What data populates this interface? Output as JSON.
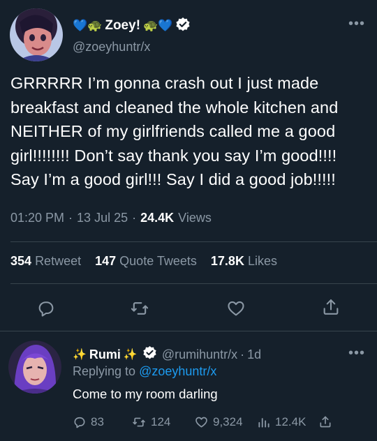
{
  "tweet": {
    "author": {
      "prefix_emoji": "💙🐢",
      "name": "Zoey!",
      "suffix_emoji": "🐢💙",
      "handle": "@zoeyhuntr/x"
    },
    "text": "GRRRRR I’m gonna crash out I just made breakfast and cleaned the whole kitchen and NEITHER of my girlfriends called me a good girl!!!!!!!! Don’t say thank you say I’m good!!!! Say I’m a good girl!!! Say I did a good job!!!!!",
    "time": "01:20 PM",
    "date": "13 Jul 25",
    "views_count": "24.4K",
    "views_label": "Views",
    "stats": {
      "retweets": "354",
      "retweets_label": "Retweet",
      "quotes": "147",
      "quotes_label": "Quote Tweets",
      "likes": "17.8K",
      "likes_label": "Likes"
    }
  },
  "reply": {
    "author": {
      "prefix_emoji": "✨",
      "name": "Rumi",
      "suffix_emoji": "✨",
      "handle": "@rumihuntr/x",
      "age": "1d"
    },
    "replying_to_label": "Replying to",
    "replying_to": "@zoeyhuntr/x",
    "text": "Come to my room darling",
    "actions": {
      "replies": "83",
      "retweets": "124",
      "likes": "9,324",
      "views": "12.4K"
    }
  },
  "colors": {
    "background": "#15202b",
    "accent": "#1d9bf0",
    "muted": "#8b98a5",
    "divider": "#38444d"
  },
  "icons": [
    "verified-badge-icon",
    "more-icon",
    "reply-icon",
    "retweet-icon",
    "like-icon",
    "share-icon",
    "views-icon"
  ],
  "separators": {
    "dot": "·"
  }
}
